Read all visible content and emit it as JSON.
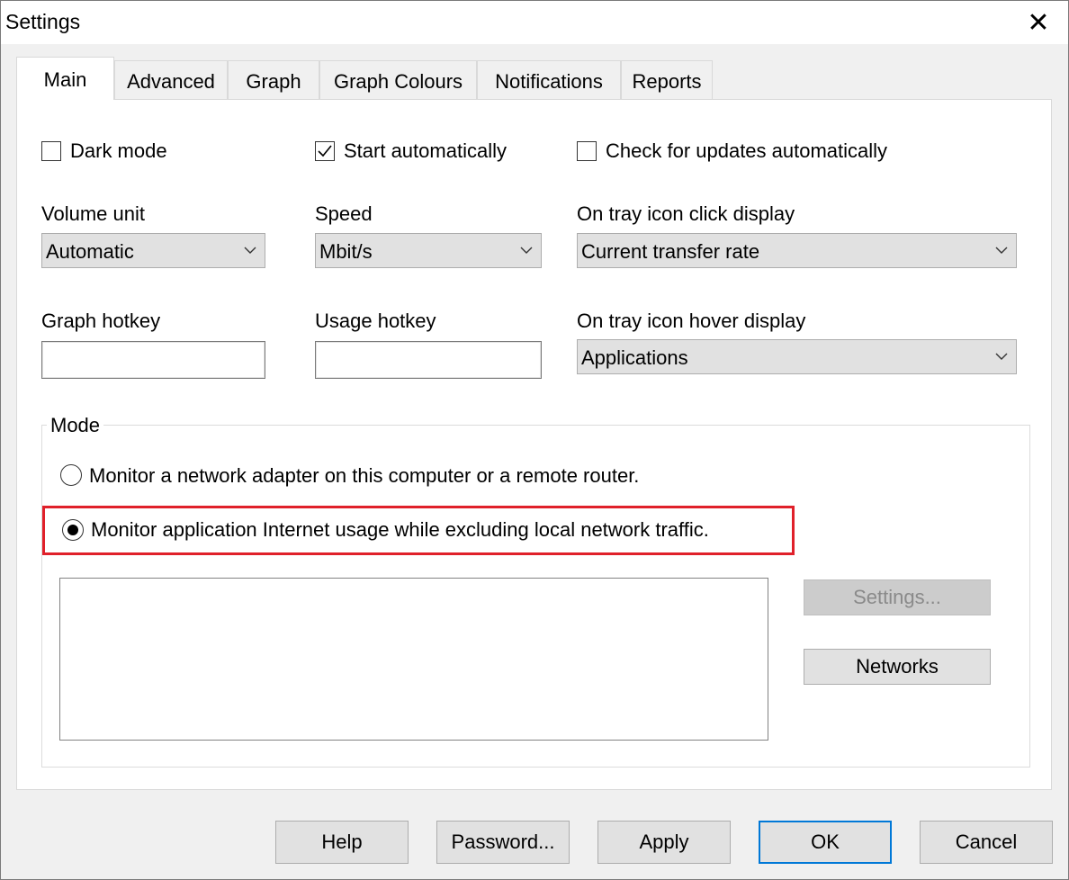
{
  "window": {
    "title": "Settings",
    "close_glyph": "✕"
  },
  "tabs": [
    {
      "label": "Main",
      "active": true
    },
    {
      "label": "Advanced"
    },
    {
      "label": "Graph"
    },
    {
      "label": "Graph Colours"
    },
    {
      "label": "Notifications"
    },
    {
      "label": "Reports"
    }
  ],
  "main": {
    "checkboxes": {
      "dark_mode": {
        "label": "Dark mode",
        "checked": false
      },
      "start_automatically": {
        "label": "Start automatically",
        "checked": true
      },
      "check_updates": {
        "label": "Check for updates automatically",
        "checked": false
      }
    },
    "volume_unit": {
      "label": "Volume unit",
      "value": "Automatic"
    },
    "speed": {
      "label": "Speed",
      "value": "Mbit/s"
    },
    "tray_click": {
      "label": "On tray icon click display",
      "value": "Current transfer rate"
    },
    "graph_hotkey": {
      "label": "Graph hotkey",
      "value": ""
    },
    "usage_hotkey": {
      "label": "Usage hotkey",
      "value": ""
    },
    "tray_hover": {
      "label": "On tray icon hover display",
      "value": "Applications"
    },
    "mode": {
      "legend": "Mode",
      "option_adapter": {
        "label": "Monitor a network adapter on this computer or a remote router.",
        "selected": false
      },
      "option_application": {
        "label": "Monitor application Internet usage while excluding local network traffic.",
        "selected": true
      },
      "settings_button": "Settings...",
      "networks_button": "Networks"
    }
  },
  "footer": {
    "help": "Help",
    "password": "Password...",
    "apply": "Apply",
    "ok": "OK",
    "cancel": "Cancel"
  },
  "colors": {
    "highlight": "#e0202a",
    "default_button_border": "#0078d7"
  }
}
